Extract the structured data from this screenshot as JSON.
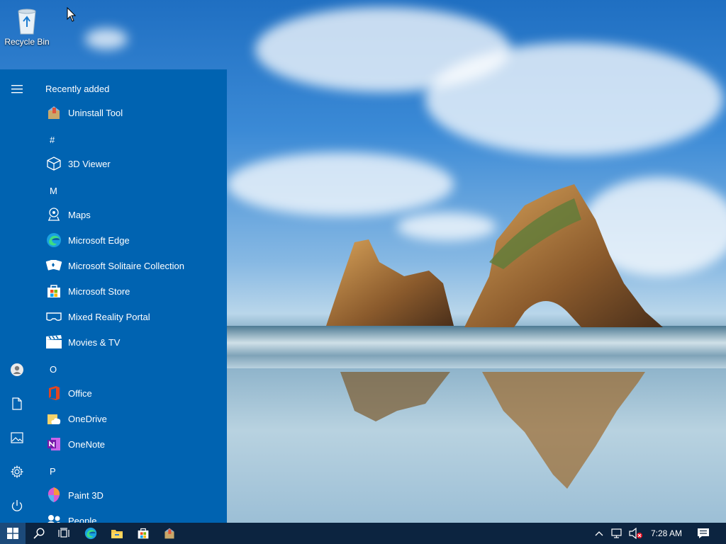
{
  "desktop": {
    "icons": [
      {
        "label": "Recycle Bin",
        "icon": "recycle-bin-icon"
      }
    ]
  },
  "start_menu": {
    "section_title": "Recently added",
    "rail": [
      {
        "icon": "hamburger-menu-icon"
      },
      {
        "icon": "user-account-icon"
      },
      {
        "icon": "documents-icon"
      },
      {
        "icon": "pictures-icon"
      },
      {
        "icon": "settings-gear-icon"
      },
      {
        "icon": "power-icon"
      }
    ],
    "items": [
      {
        "type": "app",
        "label": "Uninstall Tool",
        "icon": "uninstall-tool-icon"
      },
      {
        "type": "letter",
        "label": "#"
      },
      {
        "type": "app",
        "label": "3D Viewer",
        "icon": "3d-viewer-icon"
      },
      {
        "type": "letter",
        "label": "M"
      },
      {
        "type": "app",
        "label": "Maps",
        "icon": "maps-icon"
      },
      {
        "type": "app",
        "label": "Microsoft Edge",
        "icon": "edge-icon"
      },
      {
        "type": "app",
        "label": "Microsoft Solitaire Collection",
        "icon": "solitaire-icon"
      },
      {
        "type": "app",
        "label": "Microsoft Store",
        "icon": "store-icon"
      },
      {
        "type": "app",
        "label": "Mixed Reality Portal",
        "icon": "mixed-reality-icon"
      },
      {
        "type": "app",
        "label": "Movies & TV",
        "icon": "movies-tv-icon"
      },
      {
        "type": "letter",
        "label": "O"
      },
      {
        "type": "app",
        "label": "Office",
        "icon": "office-icon"
      },
      {
        "type": "app",
        "label": "OneDrive",
        "icon": "onedrive-icon"
      },
      {
        "type": "app",
        "label": "OneNote",
        "icon": "onenote-icon"
      },
      {
        "type": "letter",
        "label": "P"
      },
      {
        "type": "app",
        "label": "Paint 3D",
        "icon": "paint-3d-icon"
      },
      {
        "type": "app",
        "label": "People",
        "icon": "people-icon"
      }
    ]
  },
  "taskbar": {
    "buttons": [
      {
        "icon": "windows-start-icon"
      },
      {
        "icon": "search-icon"
      },
      {
        "icon": "task-view-icon"
      },
      {
        "icon": "edge-icon"
      },
      {
        "icon": "file-explorer-icon"
      },
      {
        "icon": "store-icon"
      },
      {
        "icon": "uninstall-tool-icon"
      }
    ],
    "tray": {
      "icons": [
        "chevron-up-icon",
        "network-icon",
        "volume-muted-icon"
      ],
      "time": "7:28 AM",
      "notification_icon": "action-center-icon"
    }
  },
  "colors": {
    "start_bg": "#0063b1",
    "taskbar_bg": "#0c2440"
  }
}
